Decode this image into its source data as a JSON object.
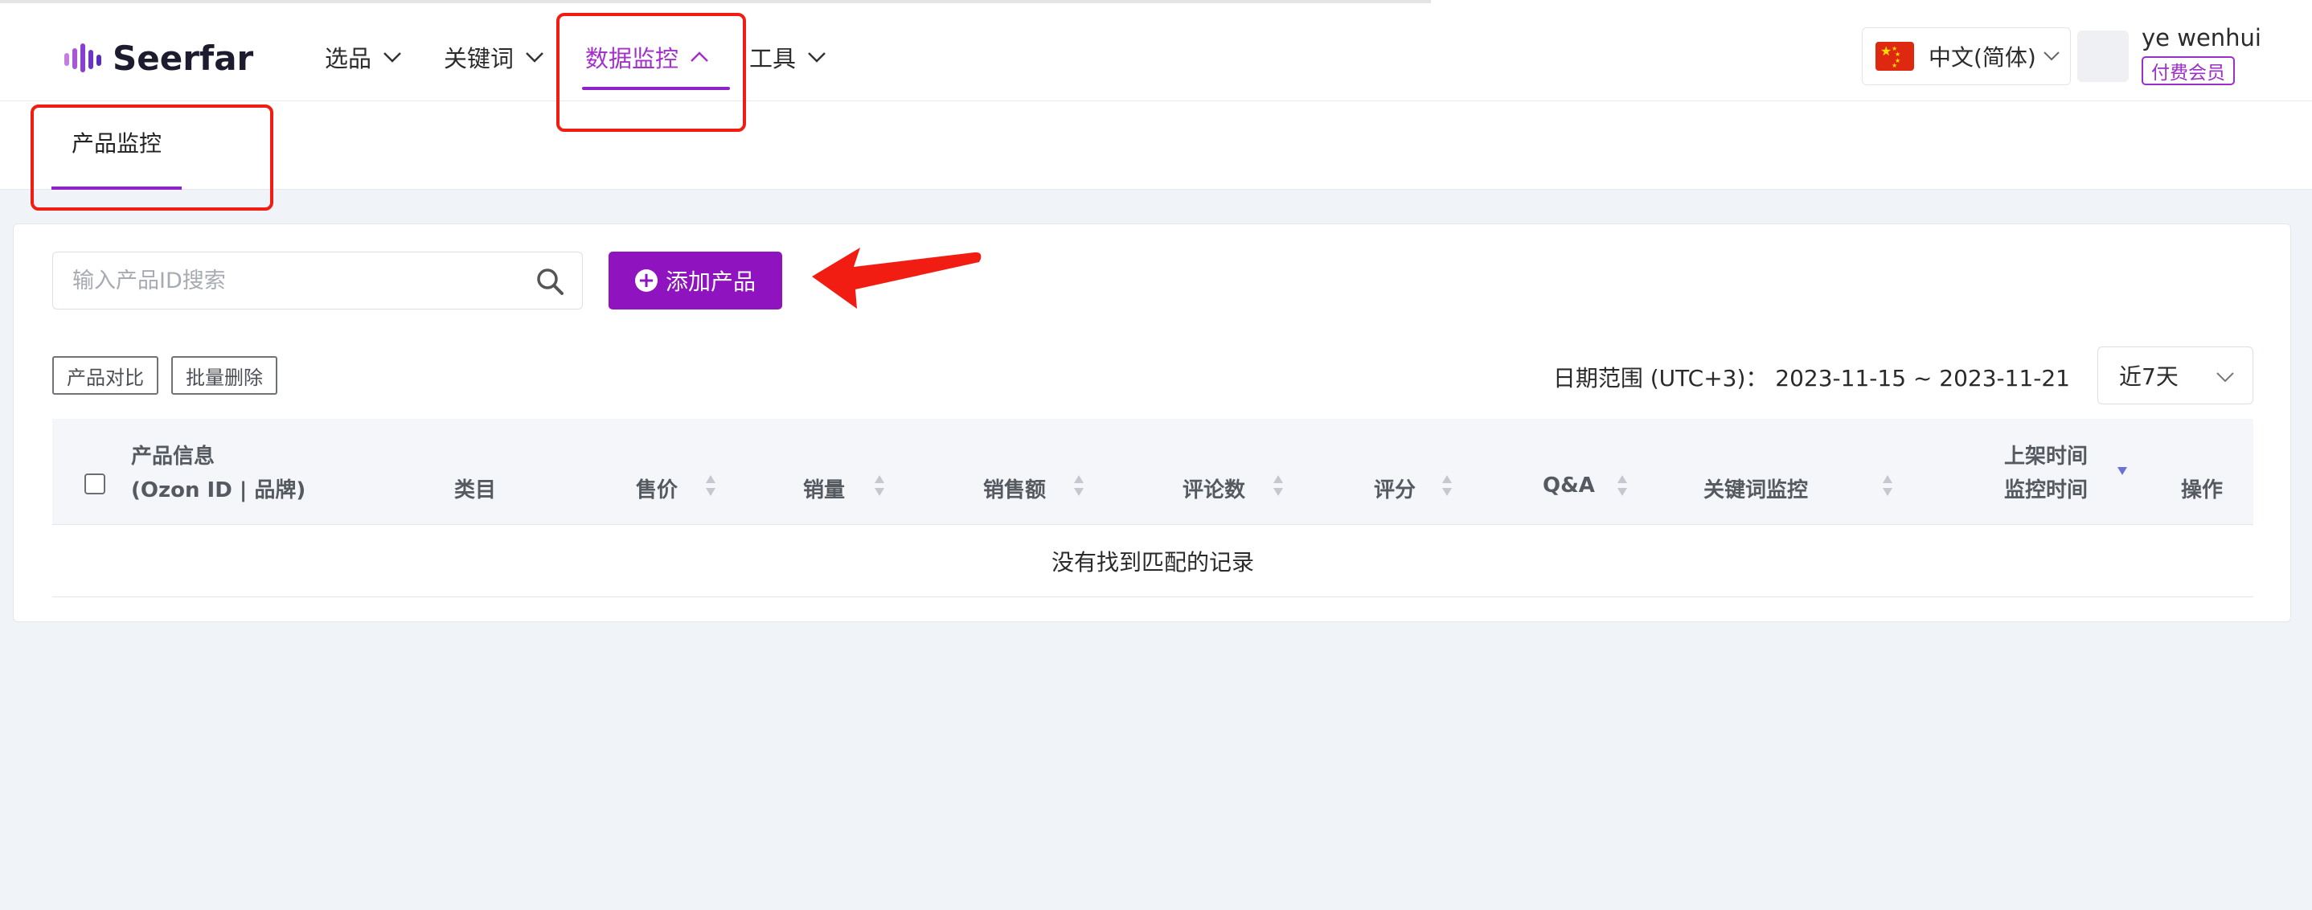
{
  "brand": {
    "name": "Seerfar"
  },
  "nav": {
    "items": [
      {
        "label": "选品"
      },
      {
        "label": "关键词"
      },
      {
        "label": "数据监控"
      },
      {
        "label": "工具"
      }
    ],
    "active": "数据监控"
  },
  "language": {
    "label": "中文(简体)"
  },
  "user": {
    "name": "ye wenhui",
    "badge": "付费会员"
  },
  "subnav": {
    "tab": "产品监控"
  },
  "search": {
    "placeholder": "输入产品ID搜索",
    "value": ""
  },
  "toolbar": {
    "add_label": "添加产品",
    "compare_label": "产品对比",
    "batch_delete_label": "批量删除"
  },
  "date_range": {
    "text": "日期范围 (UTC+3)： 2023-11-15 ~ 2023-11-21"
  },
  "period": {
    "selected": "近7天"
  },
  "table": {
    "headers": {
      "product_info_1": "产品信息",
      "product_info_2": "(Ozon ID | 品牌)",
      "category": "类目",
      "price": "售价",
      "sales": "销量",
      "revenue": "销售额",
      "reviews": "评论数",
      "rating": "评分",
      "qa": "Q&A",
      "keyword_monitor": "关键词监控",
      "listing_time": "上架时间",
      "monitor_time": "监控时间",
      "actions": "操作"
    },
    "empty_message": "没有找到匹配的记录"
  },
  "colors": {
    "accent": "#9013c0",
    "annotation": "#f21d12",
    "page_bg": "#f0f3f7"
  },
  "icons": [
    "logo-mark-icon",
    "chevron-down-icon",
    "chevron-up-icon",
    "china-flag-icon",
    "search-icon",
    "plus-circle-icon",
    "sort-icon",
    "sort-desc-icon",
    "annotation-arrow-icon"
  ]
}
